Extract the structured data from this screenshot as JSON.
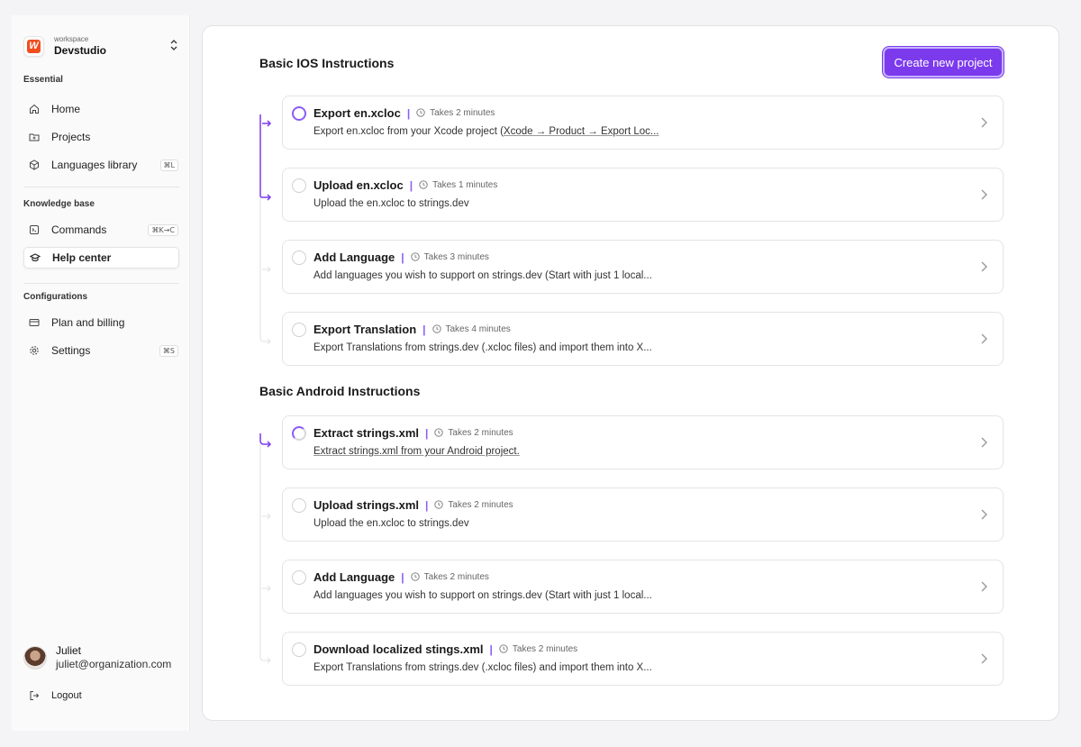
{
  "workspace": {
    "label": "workspace",
    "name": "Devstudio"
  },
  "sidebar": {
    "sections": [
      {
        "label": "Essential"
      },
      {
        "label": "Knowledge base"
      },
      {
        "label": "Configurations"
      }
    ],
    "items": [
      {
        "label": "Home",
        "icon": "home-icon"
      },
      {
        "label": "Projects",
        "icon": "folder-icon"
      },
      {
        "label": "Languages library",
        "icon": "cube-icon",
        "shortcut": "⌘L"
      },
      {
        "label": "Commands",
        "icon": "terminal-icon",
        "shortcut": "⌘K→C"
      },
      {
        "label": "Help center",
        "icon": "graduation-cap-icon",
        "active": true
      },
      {
        "label": "Plan and billing",
        "icon": "credit-card-icon"
      },
      {
        "label": "Settings",
        "icon": "gear-icon",
        "shortcut": "⌘S"
      }
    ]
  },
  "user": {
    "name": "Juliet",
    "email": "juliet@organization.com",
    "logout": "Logout"
  },
  "main": {
    "create_button": "Create new project",
    "groups": [
      {
        "title": "Basic IOS Instructions",
        "steps": [
          {
            "title": "Export en.xcloc",
            "time": "Takes 2 minutes",
            "desc_plain": "Export en.xcloc from your Xcode project (",
            "desc_link": "Xcode → Product → Export Loc...",
            "status": "active"
          },
          {
            "title": "Upload en.xcloc",
            "time": "Takes 1 minutes",
            "desc_plain": "Upload the en.xcloc to strings.dev",
            "status": "todo"
          },
          {
            "title": "Add Language",
            "time": "Takes 3 minutes",
            "desc_plain": "Add languages you wish to support on strings.dev (Start with just 1 local...",
            "status": "todo"
          },
          {
            "title": "Export Translation",
            "time": "Takes 4 minutes",
            "desc_plain": "Export Translations from strings.dev (.xcloc files) and import them into X...",
            "status": "todo"
          }
        ]
      },
      {
        "title": "Basic Android Instructions",
        "steps": [
          {
            "title": "Extract strings.xml",
            "time": "Takes 2 minutes",
            "desc_link": "Extract strings.xml from your Android project.",
            "status": "partial"
          },
          {
            "title": "Upload strings.xml",
            "time": "Takes 2 minutes",
            "desc_plain": "Upload the en.xcloc to strings.dev",
            "status": "todo"
          },
          {
            "title": "Add Language",
            "time": "Takes 2 minutes",
            "desc_plain": "Add languages you wish to support on strings.dev (Start with just 1 local...",
            "status": "todo"
          },
          {
            "title": "Download localized stings.xml",
            "time": "Takes 2 minutes",
            "desc_plain": "Export Translations from strings.dev (.xcloc files) and import them into X...",
            "status": "todo"
          }
        ]
      }
    ]
  },
  "colors": {
    "accent": "#7c3aed",
    "accent_light": "#8b5cf6",
    "logo": "#f04e1f"
  }
}
